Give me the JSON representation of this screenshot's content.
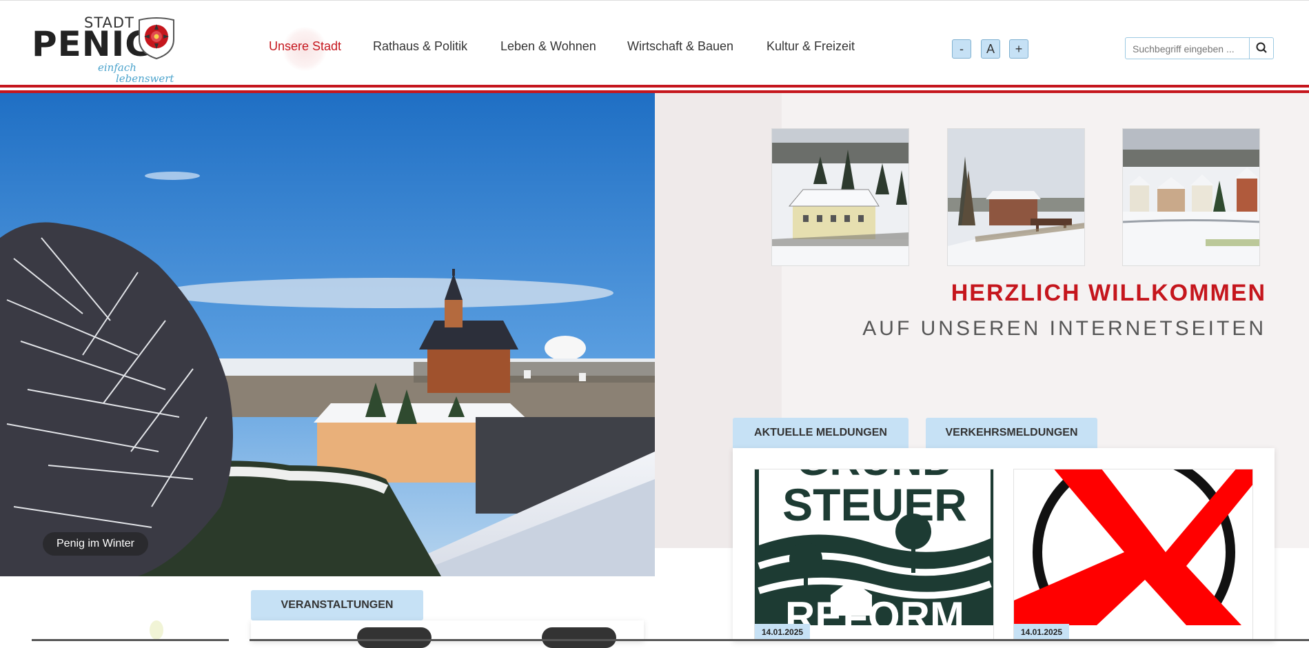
{
  "logo": {
    "stadt": "STADT",
    "name": "PENIG",
    "tagline_1": "einfach",
    "tagline_2": "lebenswert"
  },
  "nav": {
    "items": [
      {
        "label": "Unsere Stadt",
        "active": true
      },
      {
        "label": "Rathaus & Politik",
        "active": false
      },
      {
        "label": "Leben & Wohnen",
        "active": false
      },
      {
        "label": "Wirtschaft & Bauen",
        "active": false
      },
      {
        "label": "Kultur & Freizeit",
        "active": false
      }
    ]
  },
  "font_size_controls": {
    "decrease": "-",
    "reset": "A",
    "increase": "+"
  },
  "search": {
    "placeholder": "Suchbegriff eingeben ...",
    "icon": "search-icon"
  },
  "hero": {
    "caption": "Penig im Winter"
  },
  "welcome": {
    "headline": "HERZLICH WILLKOMMEN",
    "subline": "AUF UNSEREN INTERNETSEITEN"
  },
  "tabs": {
    "news": "AKTUELLE  MELDUNGEN",
    "traffic": "VERKEHRSMELDUNGEN",
    "events": "VERANSTALTUNGEN"
  },
  "news": [
    {
      "image_text_1": "GRUND",
      "image_text_2": "STEUER",
      "image_text_3": "REFORM",
      "date": "14.01.2025"
    },
    {
      "date": "14.01.2025"
    }
  ],
  "colors": {
    "brand_red": "#c5161d",
    "tab_blue": "#c6e1f5",
    "accent_blue": "#4ba3cc"
  }
}
